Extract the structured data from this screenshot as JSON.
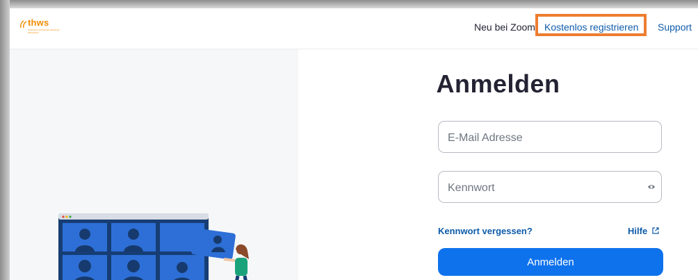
{
  "header": {
    "logo_text": "thws",
    "logo_sub": "Technische Hochschule Würzburg-Schweinfurt",
    "new_label": "Neu bei Zoom",
    "register_label": "Kostenlos registrieren",
    "support_label": "Support"
  },
  "login": {
    "title": "Anmelden",
    "email_placeholder": "E-Mail Adresse",
    "password_placeholder": "Kennwort",
    "forgot_label": "Kennwort vergessen?",
    "help_label": "Hilfe",
    "submit_label": "Anmelden"
  },
  "icons": {
    "password_visibility": "eye-icon",
    "help_external": "external-link-icon"
  },
  "colors": {
    "accent": "#0e72ed",
    "link": "#0e5baa",
    "highlight": "#ed7d31",
    "brand": "#f28c00"
  }
}
